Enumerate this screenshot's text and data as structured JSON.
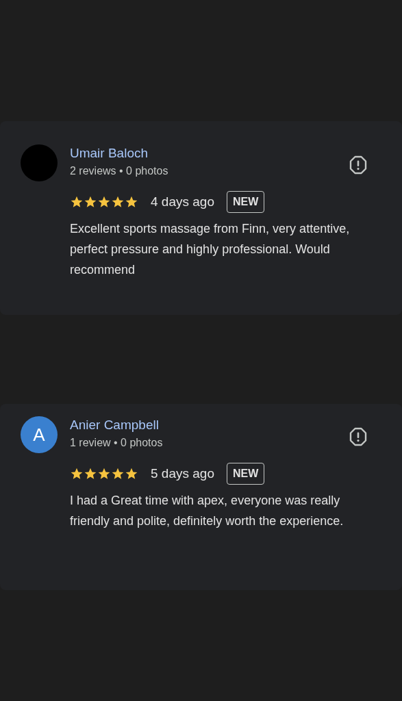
{
  "reviews": [
    {
      "avatar": {
        "color": "#000000"
      },
      "name": "Umair Baloch",
      "meta": "2 reviews • 0 photos",
      "stars": 5,
      "time": "4 days ago",
      "badge": "NEW",
      "text": "Excellent sports massage from Finn, very attentive, perfect pressure and highly professional. Would recommend"
    },
    {
      "avatar": {
        "color": "#3a80cf",
        "initial": "A"
      },
      "name": "Anier Campbell",
      "meta": "1 review • 0 photos",
      "stars": 5,
      "time": "5 days ago",
      "badge": "NEW",
      "text": "I had a Great time with apex, everyone was really friendly and polite, definitely worth the experience."
    }
  ]
}
